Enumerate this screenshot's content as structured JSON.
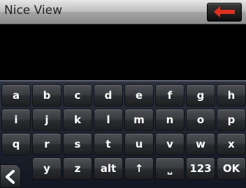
{
  "header": {
    "title": "Nice View",
    "back_icon": "arrow-left-icon",
    "accent": "#e0301e"
  },
  "keyboard": {
    "rows": [
      [
        "a",
        "b",
        "c",
        "d",
        "e",
        "f",
        "g",
        "h"
      ],
      [
        "i",
        "j",
        "k",
        "l",
        "m",
        "n",
        "o",
        "p"
      ],
      [
        "q",
        "r",
        "s",
        "t",
        "u",
        "v",
        "w",
        "x"
      ],
      [
        "y",
        "z",
        "alt",
        "↑",
        "⎵",
        "123",
        "OK"
      ]
    ]
  },
  "nav": {
    "back_icon": "chevron-left-icon"
  }
}
